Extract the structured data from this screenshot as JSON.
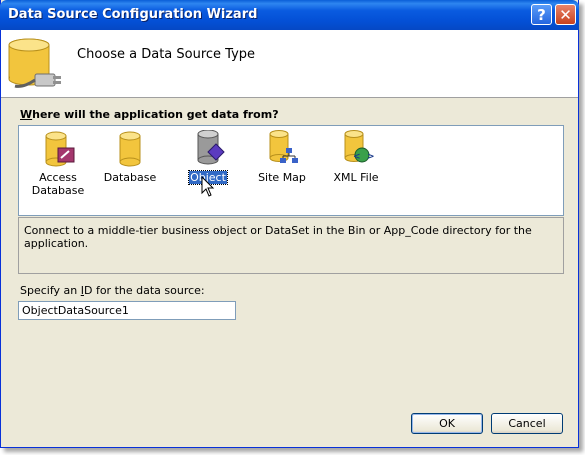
{
  "window": {
    "title": "Data Source Configuration Wizard"
  },
  "header": {
    "title": "Choose a Data Source Type"
  },
  "question": {
    "underline_char": "W",
    "rest": "here will the application get data from?"
  },
  "types": [
    {
      "label": "Access Database",
      "icon": "access-db-icon"
    },
    {
      "label": "Database",
      "icon": "database-icon"
    },
    {
      "label": "Object",
      "icon": "object-icon",
      "selected": true
    },
    {
      "label": "Site Map",
      "icon": "site-map-icon"
    },
    {
      "label": "XML File",
      "icon": "xml-file-icon"
    }
  ],
  "description": "Connect to a middle-tier business object or DataSet in the Bin or App_Code directory for the application.",
  "id_field": {
    "label_pre": "Specify an ",
    "label_key": "I",
    "label_post": "D for the data source:",
    "value": "ObjectDataSource1"
  },
  "buttons": {
    "ok": "OK",
    "cancel": "Cancel"
  },
  "colors": {
    "title_bar": "#0a5be0",
    "selection": "#316ac5",
    "cylinder": "#f2c53d"
  }
}
